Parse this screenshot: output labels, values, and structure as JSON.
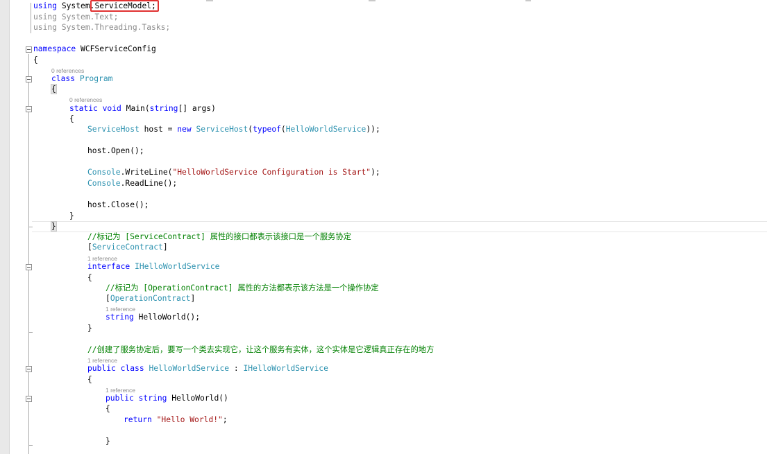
{
  "colors": {
    "keyword": "#0000ff",
    "type": "#2b91af",
    "string": "#a31515",
    "comment": "#008000",
    "plain": "#000000",
    "dimmed": "#8a8a8a",
    "lens": "#8c8c8c",
    "callout": "#e03030"
  },
  "code_lines": [
    {
      "id": "using-servicemodel",
      "tokens": [
        {
          "t": "using",
          "k": "keyword"
        },
        {
          "t": " System.",
          "k": "plain"
        },
        {
          "t": "ServiceModel;",
          "k": "plain"
        }
      ]
    },
    {
      "id": "using-text",
      "tokens": [
        {
          "t": "using System.Text;",
          "k": "dimmed"
        }
      ]
    },
    {
      "id": "using-tasks",
      "tokens": [
        {
          "t": "using System.Threading.Tasks;",
          "k": "dimmed"
        }
      ]
    },
    {
      "id": "namespace-decl",
      "tokens": [
        {
          "t": "namespace",
          "k": "keyword"
        },
        {
          "t": " WCFServiceConfig",
          "k": "plain"
        }
      ]
    },
    {
      "id": "namespace-open",
      "tokens": [
        {
          "t": "{",
          "k": "plain"
        }
      ]
    },
    {
      "id": "class-program",
      "tokens": [
        {
          "t": "class",
          "k": "keyword"
        },
        {
          "t": " ",
          "k": "plain"
        },
        {
          "t": "Program",
          "k": "type"
        }
      ]
    },
    {
      "id": "class-open",
      "tokens": [
        {
          "t": "{",
          "k": "plain",
          "hl": true
        }
      ]
    },
    {
      "id": "main-decl",
      "tokens": [
        {
          "t": "static",
          "k": "keyword"
        },
        {
          "t": " ",
          "k": "plain"
        },
        {
          "t": "void",
          "k": "keyword"
        },
        {
          "t": " Main(",
          "k": "plain"
        },
        {
          "t": "string",
          "k": "keyword"
        },
        {
          "t": "[] args)",
          "k": "plain"
        }
      ]
    },
    {
      "id": "main-open",
      "tokens": [
        {
          "t": "{",
          "k": "plain"
        }
      ]
    },
    {
      "id": "host-new",
      "tokens": [
        {
          "t": "ServiceHost",
          "k": "type"
        },
        {
          "t": " host = ",
          "k": "plain"
        },
        {
          "t": "new",
          "k": "keyword"
        },
        {
          "t": " ",
          "k": "plain"
        },
        {
          "t": "ServiceHost",
          "k": "type"
        },
        {
          "t": "(",
          "k": "plain"
        },
        {
          "t": "typeof",
          "k": "keyword"
        },
        {
          "t": "(",
          "k": "plain"
        },
        {
          "t": "HelloWorldService",
          "k": "type"
        },
        {
          "t": "));",
          "k": "plain"
        }
      ]
    },
    {
      "id": "host-open",
      "tokens": [
        {
          "t": "host.Open();",
          "k": "plain"
        }
      ]
    },
    {
      "id": "console-writeline",
      "tokens": [
        {
          "t": "Console",
          "k": "type"
        },
        {
          "t": ".WriteLine(",
          "k": "plain"
        },
        {
          "t": "\"HelloWorldService Configuration is Start\"",
          "k": "string"
        },
        {
          "t": ");",
          "k": "plain"
        }
      ]
    },
    {
      "id": "console-readline",
      "tokens": [
        {
          "t": "Console",
          "k": "type"
        },
        {
          "t": ".ReadLine();",
          "k": "plain"
        }
      ]
    },
    {
      "id": "host-close",
      "tokens": [
        {
          "t": "host.Close();",
          "k": "plain"
        }
      ]
    },
    {
      "id": "main-close",
      "tokens": [
        {
          "t": "}",
          "k": "plain"
        }
      ]
    },
    {
      "id": "class-close",
      "tokens": [
        {
          "t": "}",
          "k": "plain",
          "hl": true
        }
      ]
    },
    {
      "id": "comment-servicecontract",
      "tokens": [
        {
          "t": "//标记为 [ServiceContract] 属性的接口都表示该接口是一个服务协定",
          "k": "comment"
        }
      ]
    },
    {
      "id": "attr-servicecontract",
      "tokens": [
        {
          "t": "[",
          "k": "plain"
        },
        {
          "t": "ServiceContract",
          "k": "type"
        },
        {
          "t": "]",
          "k": "plain"
        }
      ]
    },
    {
      "id": "interface-decl",
      "tokens": [
        {
          "t": "interface",
          "k": "keyword"
        },
        {
          "t": " ",
          "k": "plain"
        },
        {
          "t": "IHelloWorldService",
          "k": "type"
        }
      ]
    },
    {
      "id": "interface-open",
      "tokens": [
        {
          "t": "{",
          "k": "plain"
        }
      ]
    },
    {
      "id": "comment-operationcontract",
      "tokens": [
        {
          "t": "//标记为 [OperationContract] 属性的方法都表示该方法是一个操作协定",
          "k": "comment"
        }
      ]
    },
    {
      "id": "attr-operationcontract",
      "tokens": [
        {
          "t": "[",
          "k": "plain"
        },
        {
          "t": "OperationContract",
          "k": "type"
        },
        {
          "t": "]",
          "k": "plain"
        }
      ]
    },
    {
      "id": "interface-method",
      "tokens": [
        {
          "t": "string",
          "k": "keyword"
        },
        {
          "t": " HelloWorld();",
          "k": "plain"
        }
      ]
    },
    {
      "id": "interface-close",
      "tokens": [
        {
          "t": "}",
          "k": "plain"
        }
      ]
    },
    {
      "id": "comment-implementation",
      "tokens": [
        {
          "t": "//创建了服务协定后，要写一个类去实现它，让这个服务有实体，这个实体是它逻辑真正存在的地方",
          "k": "comment"
        }
      ]
    },
    {
      "id": "class-service-decl",
      "tokens": [
        {
          "t": "public",
          "k": "keyword"
        },
        {
          "t": " ",
          "k": "plain"
        },
        {
          "t": "class",
          "k": "keyword"
        },
        {
          "t": " ",
          "k": "plain"
        },
        {
          "t": "HelloWorldService",
          "k": "type"
        },
        {
          "t": " : ",
          "k": "plain"
        },
        {
          "t": "IHelloWorldService",
          "k": "type"
        }
      ]
    },
    {
      "id": "class-service-open",
      "tokens": [
        {
          "t": "{",
          "k": "plain"
        }
      ]
    },
    {
      "id": "method-decl",
      "tokens": [
        {
          "t": "public",
          "k": "keyword"
        },
        {
          "t": " ",
          "k": "plain"
        },
        {
          "t": "string",
          "k": "keyword"
        },
        {
          "t": " HelloWorld()",
          "k": "plain"
        }
      ]
    },
    {
      "id": "method-open",
      "tokens": [
        {
          "t": "{",
          "k": "plain"
        }
      ]
    },
    {
      "id": "return-stmt",
      "tokens": [
        {
          "t": "return",
          "k": "keyword"
        },
        {
          "t": " ",
          "k": "plain"
        },
        {
          "t": "\"Hello World!\"",
          "k": "string"
        },
        {
          "t": ";",
          "k": "plain"
        }
      ]
    },
    {
      "id": "method-close",
      "tokens": [
        {
          "t": "}",
          "k": "plain"
        }
      ]
    }
  ],
  "code_lens": [
    {
      "id": "lens-program",
      "text": "0 references"
    },
    {
      "id": "lens-main",
      "text": "0 references"
    },
    {
      "id": "lens-interface",
      "text": "1 reference"
    },
    {
      "id": "lens-interface-method",
      "text": "1 reference"
    },
    {
      "id": "lens-service-class",
      "text": "1 reference"
    },
    {
      "id": "lens-service-method",
      "text": "1 reference"
    }
  ],
  "outline_buttons": [
    "namespace",
    "class-program",
    "main",
    "interface",
    "class-service",
    "method"
  ]
}
